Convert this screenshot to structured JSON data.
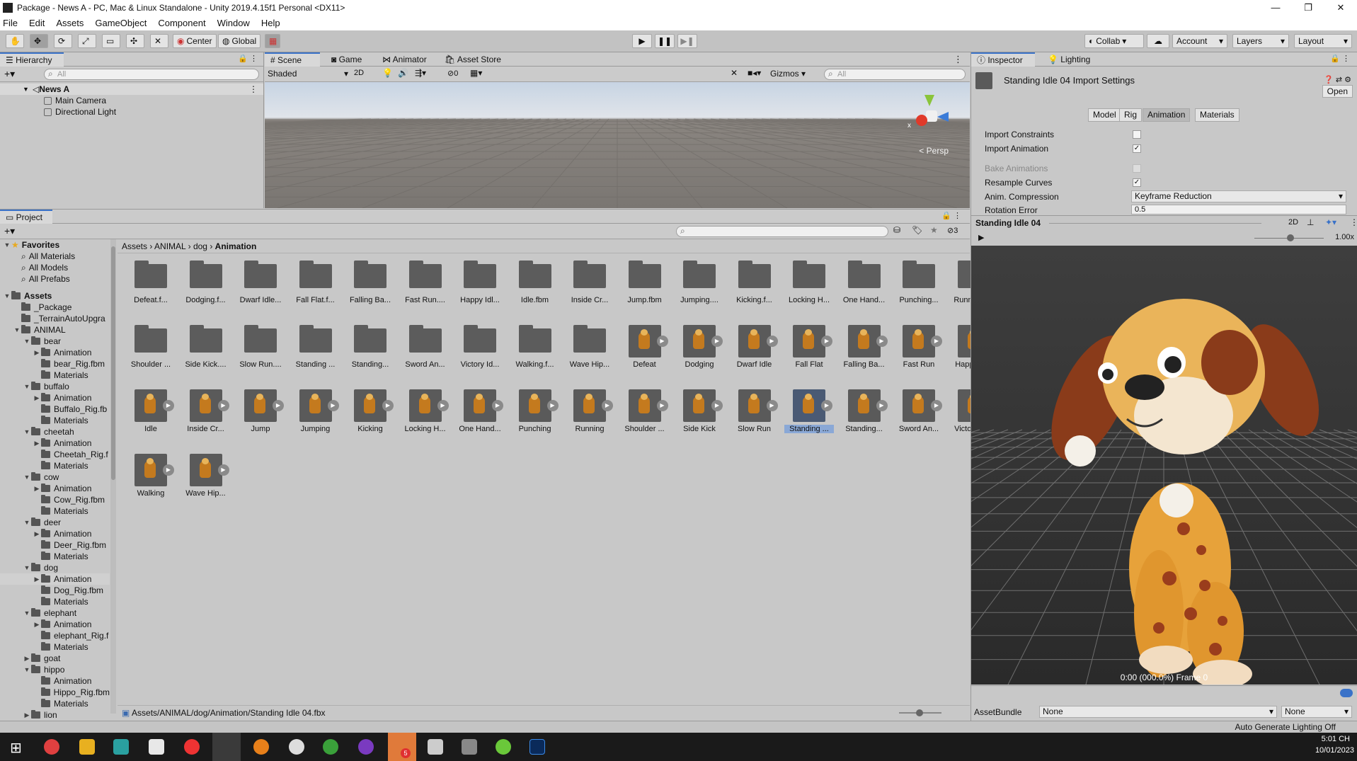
{
  "window": {
    "title": "Package - News A - PC, Mac & Linux Standalone - Unity 2019.4.15f1 Personal <DX11>",
    "controls": [
      "—",
      "❐",
      "✕"
    ]
  },
  "menu": [
    "File",
    "Edit",
    "Assets",
    "GameObject",
    "Component",
    "Window",
    "Help"
  ],
  "toolbar": {
    "pivot": "Center",
    "space": "Global",
    "collab": "Collab",
    "account": "Account",
    "layers": "Layers",
    "layout": "Layout"
  },
  "hierarchy": {
    "tab": "Hierarchy",
    "search_placeholder": "All",
    "scene": "News A",
    "objects": [
      "Main Camera",
      "Directional Light"
    ]
  },
  "scene": {
    "tabs": [
      "Scene",
      "Game",
      "Animator",
      "Asset Store"
    ],
    "shading": "Shaded",
    "mode_2d": "2D",
    "hidden_count": "0",
    "gizmos": "Gizmos",
    "search_placeholder": "All",
    "persp_label": "< Persp",
    "axis_x": "x"
  },
  "project": {
    "tab": "Project",
    "hidden_count": "3",
    "favorites_label": "Favorites",
    "favorites": [
      "All Materials",
      "All Models",
      "All Prefabs"
    ],
    "assets_label": "Assets",
    "tree": [
      {
        "label": "_Package",
        "depth": 1,
        "arrow": ""
      },
      {
        "label": "_TerrainAutoUpgra",
        "depth": 1,
        "arrow": ""
      },
      {
        "label": "ANIMAL",
        "depth": 1,
        "arrow": "▼"
      },
      {
        "label": "bear",
        "depth": 2,
        "arrow": "▼"
      },
      {
        "label": "Animation",
        "depth": 3,
        "arrow": "▶"
      },
      {
        "label": "bear_Rig.fbm",
        "depth": 3,
        "arrow": ""
      },
      {
        "label": "Materials",
        "depth": 3,
        "arrow": ""
      },
      {
        "label": "buffalo",
        "depth": 2,
        "arrow": "▼"
      },
      {
        "label": "Animation",
        "depth": 3,
        "arrow": "▶"
      },
      {
        "label": "Buffalo_Rig.fb",
        "depth": 3,
        "arrow": ""
      },
      {
        "label": "Materials",
        "depth": 3,
        "arrow": ""
      },
      {
        "label": "cheetah",
        "depth": 2,
        "arrow": "▼"
      },
      {
        "label": "Animation",
        "depth": 3,
        "arrow": "▶"
      },
      {
        "label": "Cheetah_Rig.f",
        "depth": 3,
        "arrow": ""
      },
      {
        "label": "Materials",
        "depth": 3,
        "arrow": ""
      },
      {
        "label": "cow",
        "depth": 2,
        "arrow": "▼"
      },
      {
        "label": "Animation",
        "depth": 3,
        "arrow": "▶"
      },
      {
        "label": "Cow_Rig.fbm",
        "depth": 3,
        "arrow": ""
      },
      {
        "label": "Materials",
        "depth": 3,
        "arrow": ""
      },
      {
        "label": "deer",
        "depth": 2,
        "arrow": "▼"
      },
      {
        "label": "Animation",
        "depth": 3,
        "arrow": "▶"
      },
      {
        "label": "Deer_Rig.fbm",
        "depth": 3,
        "arrow": ""
      },
      {
        "label": "Materials",
        "depth": 3,
        "arrow": ""
      },
      {
        "label": "dog",
        "depth": 2,
        "arrow": "▼"
      },
      {
        "label": "Animation",
        "depth": 3,
        "arrow": "▶",
        "selected": true
      },
      {
        "label": "Dog_Rig.fbm",
        "depth": 3,
        "arrow": ""
      },
      {
        "label": "Materials",
        "depth": 3,
        "arrow": ""
      },
      {
        "label": "elephant",
        "depth": 2,
        "arrow": "▼"
      },
      {
        "label": "Animation",
        "depth": 3,
        "arrow": "▶"
      },
      {
        "label": "elephant_Rig.f",
        "depth": 3,
        "arrow": ""
      },
      {
        "label": "Materials",
        "depth": 3,
        "arrow": ""
      },
      {
        "label": "goat",
        "depth": 2,
        "arrow": "▶"
      },
      {
        "label": "hippo",
        "depth": 2,
        "arrow": "▼"
      },
      {
        "label": "Animation",
        "depth": 3,
        "arrow": ""
      },
      {
        "label": "Hippo_Rig.fbm",
        "depth": 3,
        "arrow": ""
      },
      {
        "label": "Materials",
        "depth": 3,
        "arrow": ""
      },
      {
        "label": "lion",
        "depth": 2,
        "arrow": "▶"
      }
    ],
    "breadcrumb": [
      "Assets",
      "ANIMAL",
      "dog",
      "Animation"
    ],
    "folders": [
      "Defeat.f...",
      "Dodging.f...",
      "Dwarf Idle...",
      "Fall Flat.f...",
      "Falling Ba...",
      "Fast Run....",
      "Happy Idl...",
      "Idle.fbm",
      "Inside Cr...",
      "Jump.fbm",
      "Jumping....",
      "Kicking.f...",
      "Locking H...",
      "One Hand...",
      "Punching...",
      "Running.f...",
      "Shoulder ...",
      "Side Kick....",
      "Slow Run....",
      "Standing ...",
      "Standing...",
      "Sword An...",
      "Victory Id...",
      "Walking.f...",
      "Wave Hip..."
    ],
    "anims": [
      "Defeat",
      "Dodging",
      "Dwarf Idle",
      "Fall Flat",
      "Falling Ba...",
      "Fast Run",
      "Happy Idle",
      "Idle",
      "Inside Cr...",
      "Jump",
      "Jumping",
      "Kicking",
      "Locking H...",
      "One Hand...",
      "Punching",
      "Running",
      "Shoulder ...",
      "Side Kick",
      "Slow Run",
      "Standing ...",
      "Standing...",
      "Sword An...",
      "Victory Id...",
      "Walking",
      "Wave Hip..."
    ],
    "selected_anim": "Standing ...",
    "status_path": "Assets/ANIMAL/dog/Animation/Standing Idle 04.fbx"
  },
  "inspector": {
    "tabs": [
      "Inspector",
      "Lighting"
    ],
    "title": "Standing Idle 04 Import Settings",
    "open_button": "Open",
    "subtabs": [
      "Model",
      "Rig",
      "Animation",
      "Materials"
    ],
    "active_subtab": "Animation",
    "properties": [
      {
        "label": "Import Constraints",
        "checked": false
      },
      {
        "label": "Import Animation",
        "checked": true
      },
      {
        "label": "Bake Animations",
        "checked": false,
        "disabled": true
      },
      {
        "label": "Resample Curves",
        "checked": true
      }
    ],
    "anim_compression_label": "Anim. Compression",
    "anim_compression_value": "Keyframe Reduction",
    "rotation_error_label": "Rotation Error",
    "rotation_error_value": "0.5",
    "preview_title": "Standing Idle 04",
    "preview_2d": "2D",
    "speed": "1.00x",
    "time_readout": "0:00 (000.0%) Frame 0",
    "assetbundle_label": "AssetBundle",
    "assetbundle_value": "None",
    "assetbundle_variant": "None"
  },
  "statusbar": {
    "right": "Auto Generate Lighting Off"
  },
  "taskbar": {
    "time": "5:01 CH",
    "date": "10/01/2023",
    "badge": "5"
  },
  "colors": {
    "accent": "#3a72c8",
    "selection": "#8aa8d6",
    "preview_bg": "#3c3c3c"
  }
}
